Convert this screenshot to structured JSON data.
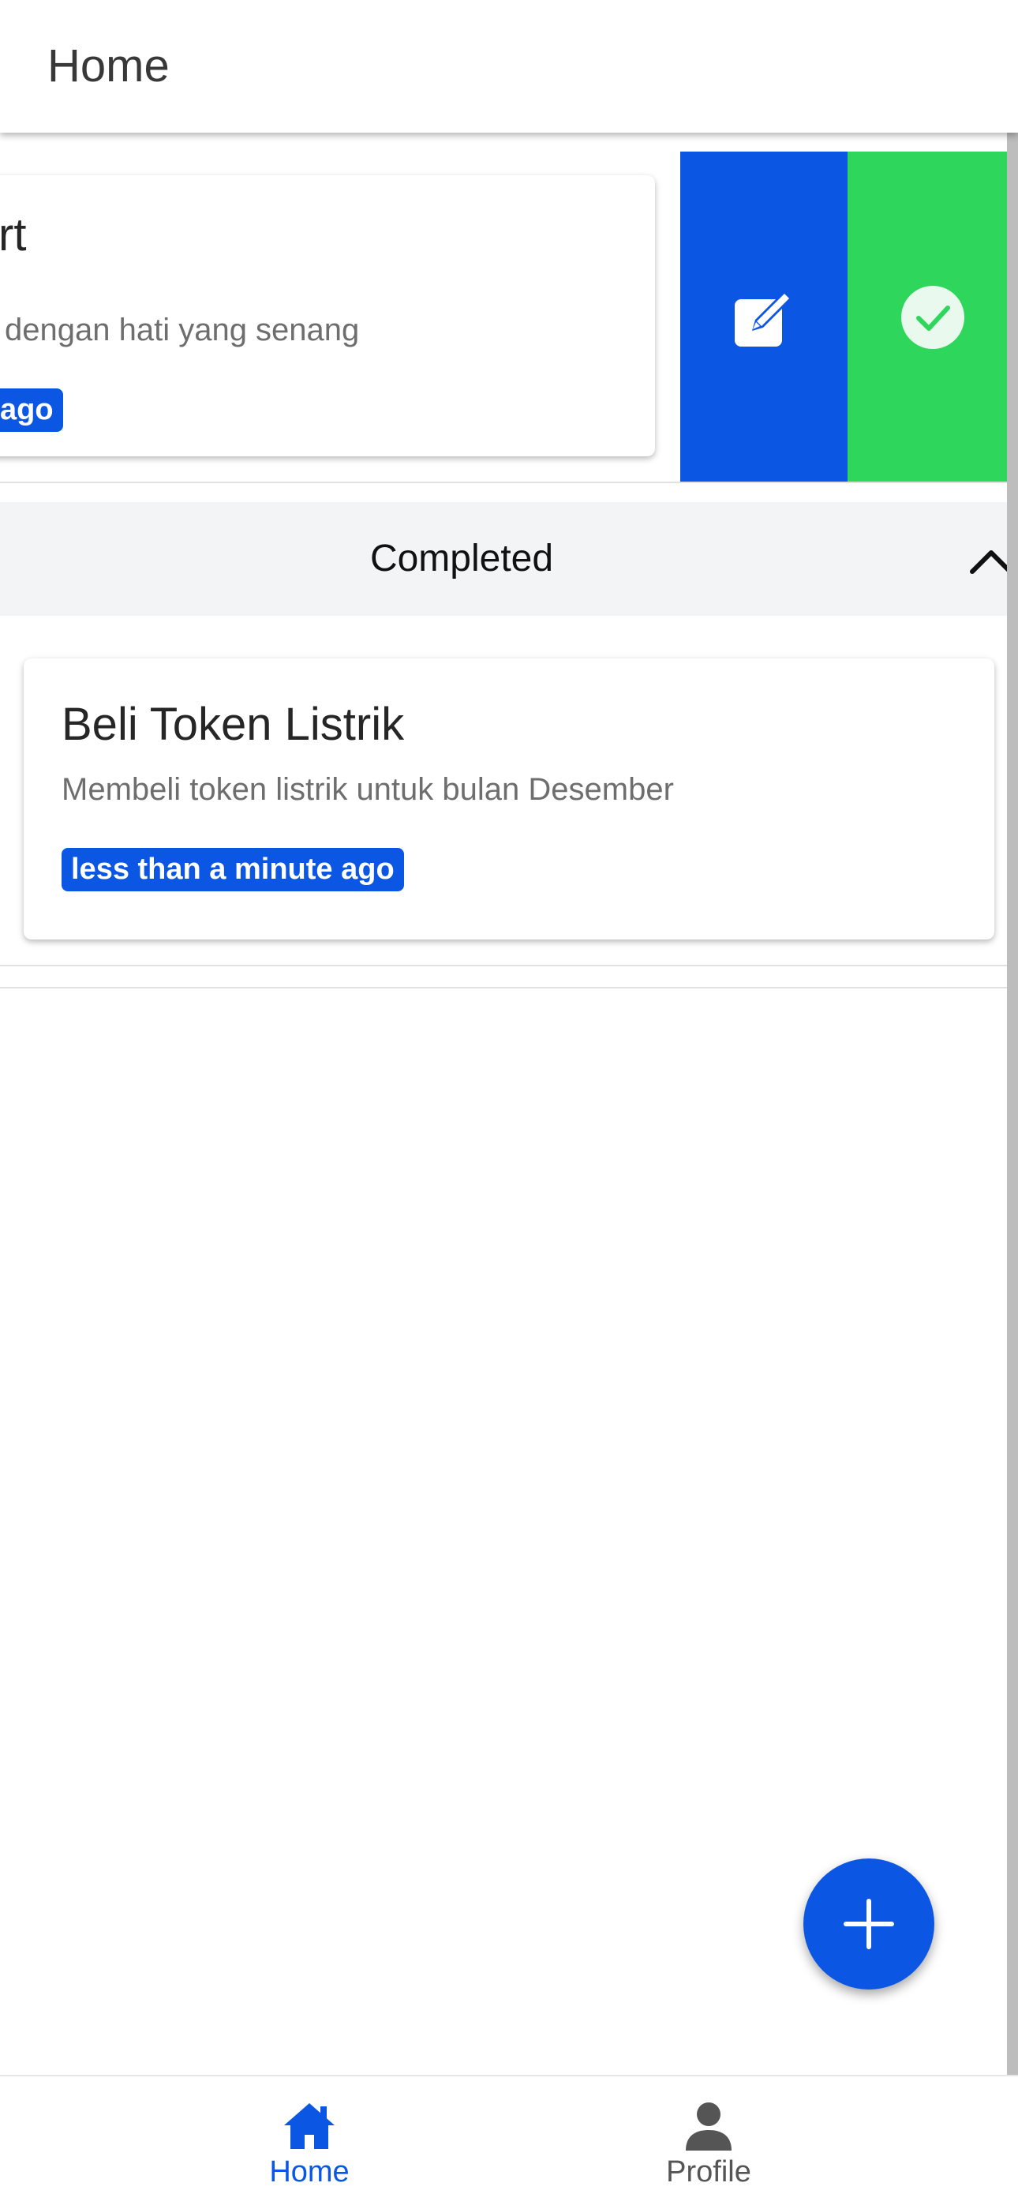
{
  "header": {
    "title": "Home"
  },
  "active_task": {
    "title": "rt",
    "description": "dengan hati yang senang",
    "time": "ago"
  },
  "swipe_actions": {
    "edit_icon": "edit-icon",
    "complete_icon": "check-circle-icon"
  },
  "completed_section": {
    "title": "Completed",
    "toggle_icon": "chevron-up-icon",
    "tasks": [
      {
        "title": "Beli Token Listrik",
        "description": "Membeli token listrik untuk bulan Desember",
        "time": "less than a minute ago"
      }
    ]
  },
  "fab": {
    "icon": "plus-icon"
  },
  "bottom_nav": {
    "items": [
      {
        "label": "Home",
        "icon": "home-icon",
        "active": true
      },
      {
        "label": "Profile",
        "icon": "person-icon",
        "active": false
      }
    ]
  },
  "colors": {
    "primary": "#0b57e4",
    "success": "#2fd65c",
    "section_bg": "#f3f4f6",
    "inactive": "#555555"
  }
}
